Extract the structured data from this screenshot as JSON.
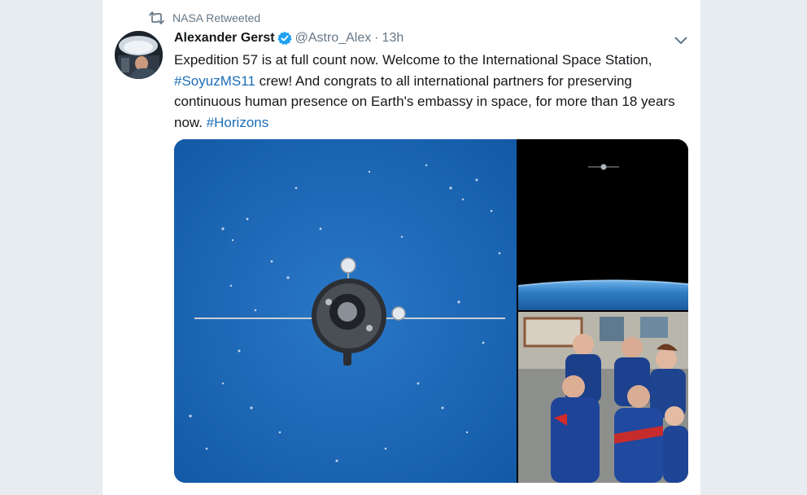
{
  "retweet": {
    "label": "NASA Retweeted",
    "icon": "retweet-icon"
  },
  "author": {
    "name": "Alexander Gerst",
    "handle": "@Astro_Alex",
    "separator": "·",
    "time": "13h",
    "verified": true,
    "avatar_icon": "avatar"
  },
  "tweet": {
    "text_1": "Expedition 57 is at full count now. Welcome to the International Space Station, ",
    "hashtag_1": "#SoyuzMS11",
    "text_2": " crew! And congrats to all international partners for preserving continuous human presence on Earth's embassy in space, for more than 18 years now. ",
    "hashtag_2": "#Horizons"
  },
  "menu": {
    "icon": "chevron-down-icon"
  },
  "media": {
    "photos": [
      {
        "name": "photo-soyuz-approach",
        "kind": "Soyuz spacecraft over ocean"
      },
      {
        "name": "photo-soyuz-horizon",
        "kind": "Soyuz above Earth horizon"
      },
      {
        "name": "photo-crew",
        "kind": "Expedition 57 crew portrait"
      }
    ]
  },
  "colors": {
    "background": "#e6ecf0",
    "card": "#ffffff",
    "text": "#14171a",
    "secondary": "#657786",
    "link": "#1b6db8",
    "verified": "#1da1f2"
  }
}
